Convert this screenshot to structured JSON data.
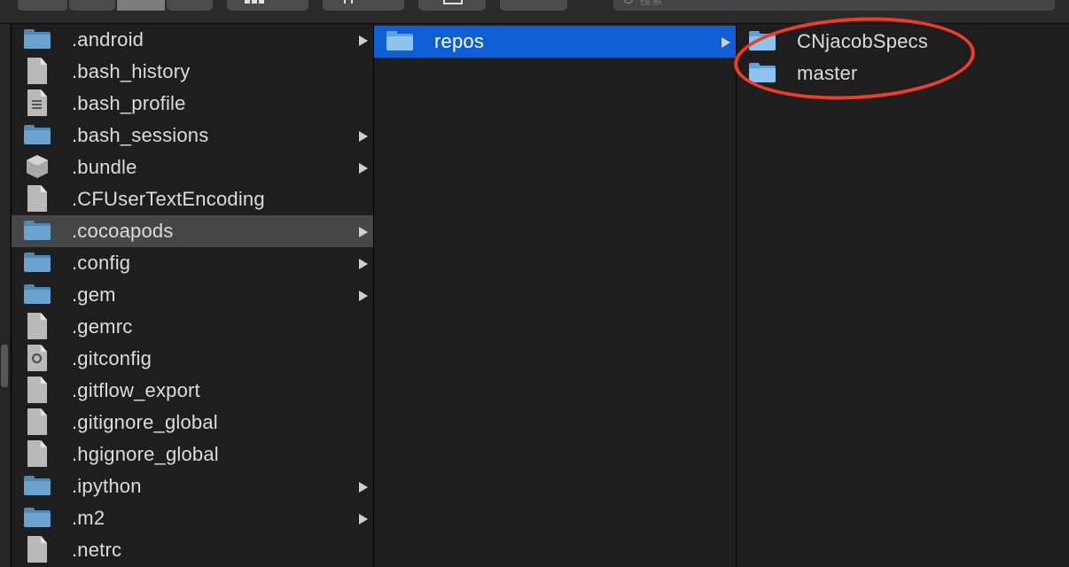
{
  "search": {
    "placeholder": "搜索"
  },
  "columns": {
    "col1": [
      {
        "name": ".android",
        "type": "folder",
        "arrow": true
      },
      {
        "name": ".bash_history",
        "type": "doc",
        "arrow": false
      },
      {
        "name": ".bash_profile",
        "type": "doc-text",
        "arrow": false
      },
      {
        "name": ".bash_sessions",
        "type": "folder",
        "arrow": true
      },
      {
        "name": ".bundle",
        "type": "bundle",
        "arrow": true
      },
      {
        "name": ".CFUserTextEncoding",
        "type": "doc",
        "arrow": false
      },
      {
        "name": ".cocoapods",
        "type": "folder",
        "arrow": true,
        "selected": "gray"
      },
      {
        "name": ".config",
        "type": "folder",
        "arrow": true
      },
      {
        "name": ".gem",
        "type": "folder",
        "arrow": true
      },
      {
        "name": ".gemrc",
        "type": "doc",
        "arrow": false
      },
      {
        "name": ".gitconfig",
        "type": "doc-gear",
        "arrow": false
      },
      {
        "name": ".gitflow_export",
        "type": "doc",
        "arrow": false
      },
      {
        "name": ".gitignore_global",
        "type": "doc",
        "arrow": false
      },
      {
        "name": ".hgignore_global",
        "type": "doc",
        "arrow": false
      },
      {
        "name": ".ipython",
        "type": "folder",
        "arrow": true
      },
      {
        "name": ".m2",
        "type": "folder",
        "arrow": true
      },
      {
        "name": ".netrc",
        "type": "doc",
        "arrow": false
      }
    ],
    "col2": [
      {
        "name": "repos",
        "type": "folder-blue",
        "arrow": true,
        "selected": "blue"
      }
    ],
    "col3": [
      {
        "name": "CNjacobSpecs",
        "type": "folder-blue",
        "arrow": false
      },
      {
        "name": "master",
        "type": "folder-blue",
        "arrow": false
      }
    ]
  },
  "colors": {
    "selection_blue": "#0e5fd6",
    "selection_gray": "#464646",
    "annotation_red": "#f03c25"
  }
}
